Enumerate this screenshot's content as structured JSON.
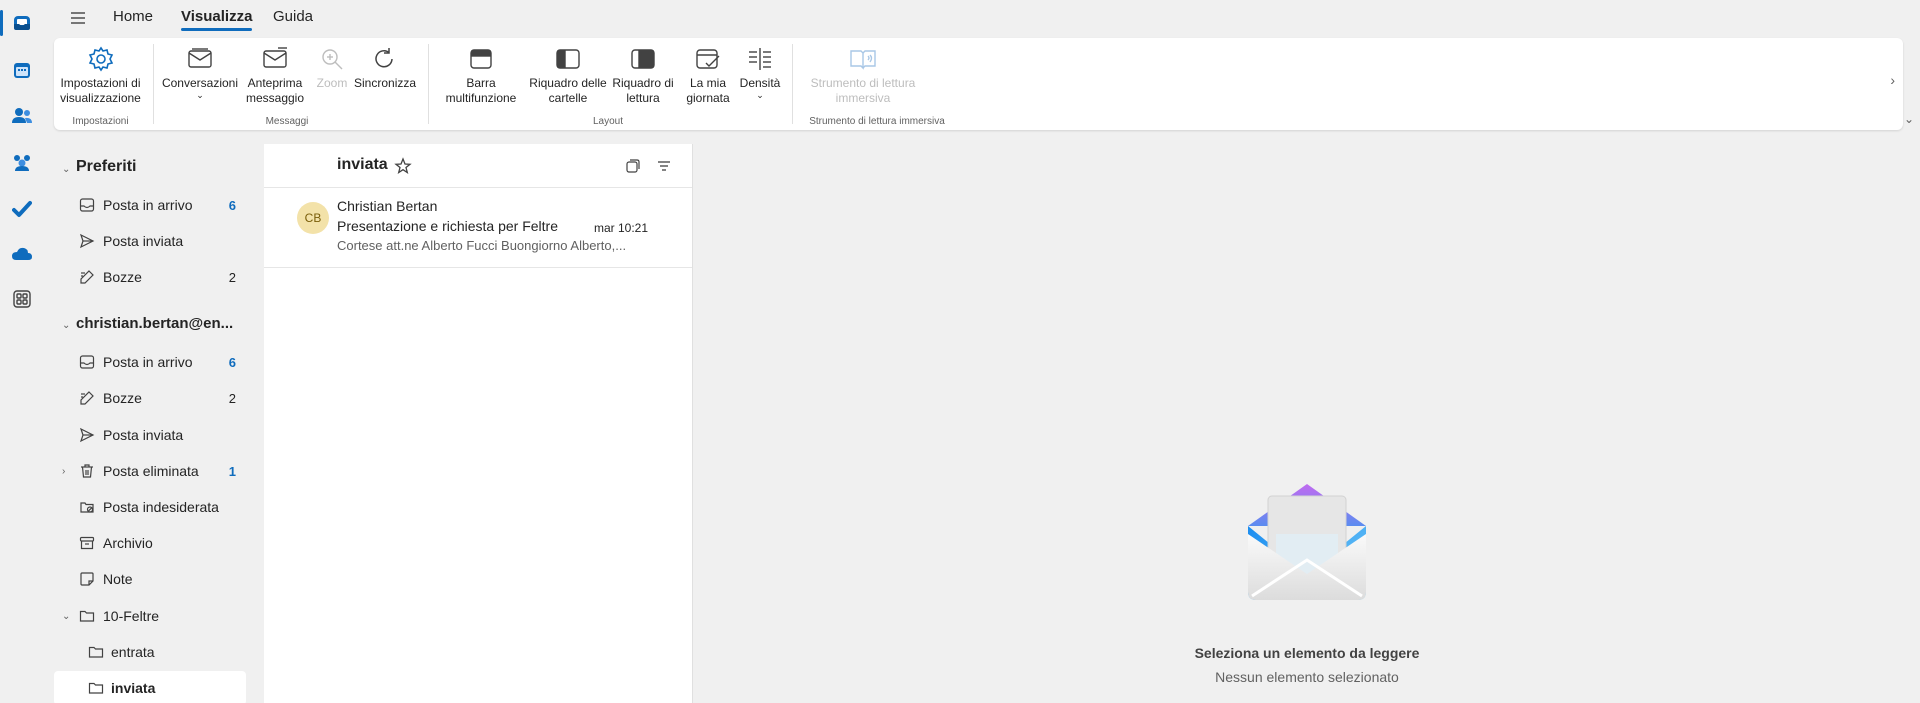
{
  "tabs": [
    {
      "label": "Home"
    },
    {
      "label": "Visualizza"
    },
    {
      "label": "Guida"
    }
  ],
  "ribbon": {
    "view_settings": "Impostazioni di visualizzazione",
    "conversations": "Conversazioni",
    "message_preview": "Anteprima messaggio",
    "zoom": "Zoom",
    "sync": "Sincronizza",
    "ribbon_bar": "Barra multifunzione",
    "folder_pane": "Riquadro delle cartelle",
    "reading_pane": "Riquadro di lettura",
    "my_day": "La mia giornata",
    "density": "Densità",
    "immersive_reader": "Strumento di lettura immersiva",
    "groups": {
      "settings": "Impostazioni",
      "messages": "Messaggi",
      "layout": "Layout",
      "immersive": "Strumento di lettura immersiva"
    }
  },
  "folders": {
    "favorites_header": "Preferiti",
    "favorites": [
      {
        "label": "Posta in arrivo",
        "count": "6",
        "icon": "inbox-icon"
      },
      {
        "label": "Posta inviata",
        "count": "",
        "icon": "send-icon"
      },
      {
        "label": "Bozze",
        "count": "2",
        "icon": "draft-icon"
      }
    ],
    "account_header": "christian.bertan@en...",
    "account": [
      {
        "label": "Posta in arrivo",
        "count": "6",
        "icon": "inbox-icon"
      },
      {
        "label": "Bozze",
        "count": "2",
        "icon": "draft-icon"
      },
      {
        "label": "Posta inviata",
        "count": "",
        "icon": "send-icon"
      },
      {
        "label": "Posta eliminata",
        "count": "1",
        "icon": "trash-icon"
      },
      {
        "label": "Posta indesiderata",
        "count": "",
        "icon": "junk-icon"
      },
      {
        "label": "Archivio",
        "count": "",
        "icon": "archive-icon"
      },
      {
        "label": "Note",
        "count": "",
        "icon": "note-icon"
      },
      {
        "label": "10-Feltre",
        "count": "",
        "icon": "folder-icon"
      },
      {
        "label": "entrata",
        "count": "",
        "icon": "folder-icon"
      },
      {
        "label": "inviata",
        "count": "",
        "icon": "folder-icon"
      }
    ]
  },
  "message_list": {
    "title": "inviata",
    "messages": [
      {
        "initials": "CB",
        "sender": "Christian Bertan",
        "subject": "Presentazione e richiesta per Feltre",
        "date": "mar 10:21",
        "preview": "Cortese att.ne Alberto Fucci Buongiorno Alberto,..."
      }
    ]
  },
  "reading_pane": {
    "title": "Seleziona un elemento da leggere",
    "subtitle": "Nessun elemento selezionato"
  },
  "colors": {
    "accent": "#0f6cbd",
    "avatar_bg": "#f3e2a9"
  }
}
